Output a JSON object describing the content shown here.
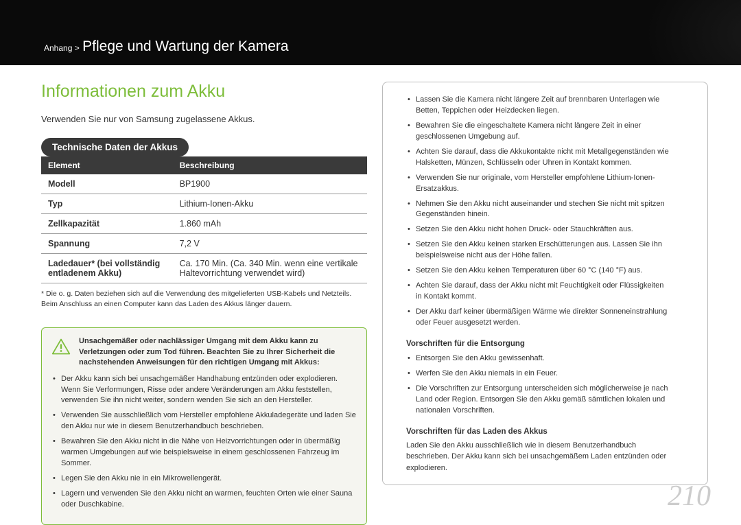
{
  "breadcrumb": {
    "prefix": "Anhang >",
    "title": "Pflege und Wartung der Kamera"
  },
  "h1": "Informationen zum Akku",
  "intro": "Verwenden Sie nur von Samsung zugelassene Akkus.",
  "pill": "Technische Daten der Akkus",
  "table": {
    "head": {
      "c1": "Element",
      "c2": "Beschreibung"
    },
    "rows": [
      {
        "c1": "Modell",
        "c2": "BP1900"
      },
      {
        "c1": "Typ",
        "c2": "Lithium-Ionen-Akku"
      },
      {
        "c1": "Zellkapazität",
        "c2": "1.860 mAh"
      },
      {
        "c1": "Spannung",
        "c2": "7,2 V"
      },
      {
        "c1": "Ladedauer* (bei vollständig entladenem Akku)",
        "c2": "Ca. 170 Min. (Ca. 340 Min. wenn eine vertikale Haltevorrichtung verwendet wird)"
      }
    ]
  },
  "footnote": "* Die o. g. Daten beziehen sich auf die Verwendung des mitgelieferten USB-Kabels und Netzteils. Beim Anschluss an einen Computer kann das Laden des Akkus länger dauern.",
  "warn": {
    "lead": "Unsachgemäßer oder nachlässiger Umgang mit dem Akku kann zu Verletzungen oder zum Tod führen. Beachten Sie zu Ihrer Sicherheit die nachstehenden Anweisungen für den richtigen Umgang mit Akkus:",
    "left": [
      "Der Akku kann sich bei unsachgemäßer Handhabung entzünden oder explodieren. Wenn Sie Verformungen, Risse oder andere Veränderungen am Akku feststellen, verwenden Sie ihn nicht weiter, sondern wenden Sie sich an den Hersteller.",
      "Verwenden Sie ausschließlich vom Hersteller empfohlene Akkuladegeräte und laden Sie den Akku nur wie in diesem Benutzerhandbuch beschrieben.",
      "Bewahren Sie den Akku nicht in die Nähe von Heizvorrichtungen oder in übermäßig warmen Umgebungen auf wie beispielsweise in einem geschlossenen Fahrzeug im Sommer.",
      "Legen Sie den Akku nie in ein Mikrowellengerät.",
      "Lagern und verwenden Sie den Akku nicht an warmen, feuchten Orten wie einer Sauna oder Duschkabine."
    ]
  },
  "right": {
    "top": [
      "Lassen Sie die Kamera nicht längere Zeit auf brennbaren Unterlagen wie Betten, Teppichen oder Heizdecken liegen.",
      "Bewahren Sie die eingeschaltete Kamera nicht längere Zeit in einer geschlossenen Umgebung auf.",
      "Achten Sie darauf, dass die Akkukontakte nicht mit Metallgegenständen wie Halsketten, Münzen, Schlüsseln oder Uhren in Kontakt kommen.",
      "Verwenden Sie nur originale, vom Hersteller empfohlene Lithium-Ionen-Ersatzakkus.",
      "Nehmen Sie den Akku nicht auseinander und stechen Sie nicht mit spitzen Gegenständen hinein.",
      "Setzen Sie den Akku nicht hohen Druck- oder Stauchkräften aus.",
      "Setzen Sie den Akku keinen starken Erschütterungen aus. Lassen Sie ihn beispielsweise nicht aus der Höhe fallen.",
      "Setzen Sie den Akku keinen Temperaturen über 60 °C (140 °F) aus.",
      "Achten Sie darauf, dass der Akku nicht mit Feuchtigkeit oder Flüssigkeiten in Kontakt kommt.",
      "Der Akku darf keiner übermäßigen Wärme wie direkter Sonneneinstrahlung oder Feuer ausgesetzt werden."
    ],
    "disp_head": "Vorschriften für die Entsorgung",
    "disp": [
      "Entsorgen Sie den Akku gewissenhaft.",
      "Werfen Sie den Akku niemals in ein Feuer.",
      "Die Vorschriften zur Entsorgung unterscheiden sich möglicherweise je nach Land oder Region. Entsorgen Sie den Akku gemäß sämtlichen lokalen und nationalen Vorschriften."
    ],
    "charge_head": "Vorschriften für das Laden des Akkus",
    "charge_text": "Laden Sie den Akku ausschließlich wie in diesem Benutzerhandbuch beschrieben. Der Akku kann sich bei unsachgemäßem Laden entzünden oder explodieren."
  },
  "pagenum": "210"
}
